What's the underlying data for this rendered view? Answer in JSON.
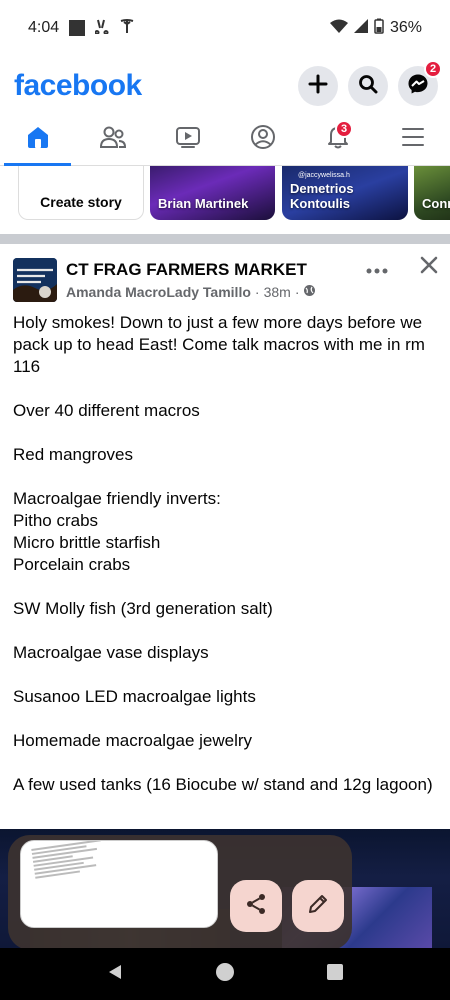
{
  "status_bar": {
    "time": "4:04",
    "battery": "36%",
    "icons": [
      "news-icon",
      "voicemail-icon",
      "tesla-icon",
      "wifi-icon",
      "signal-icon",
      "battery-icon"
    ]
  },
  "header": {
    "logo": "facebook",
    "actions": [
      {
        "name": "create-icon"
      },
      {
        "name": "search-icon"
      },
      {
        "name": "messenger-icon",
        "badge": "2"
      }
    ],
    "brand_color": "#1877f2"
  },
  "tabs": [
    {
      "name": "home",
      "icon": "home-icon",
      "active": true
    },
    {
      "name": "friends",
      "icon": "friends-icon"
    },
    {
      "name": "video",
      "icon": "video-icon"
    },
    {
      "name": "profile",
      "icon": "profile-icon"
    },
    {
      "name": "notifications",
      "icon": "bell-icon",
      "badge": "3"
    },
    {
      "name": "menu",
      "icon": "menu-icon"
    }
  ],
  "stories": {
    "create_label": "Create story",
    "items": [
      {
        "label": "Brian Martinek"
      },
      {
        "label": "Demetrios Kontoulis",
        "tag": "@jaccywelissa.h"
      },
      {
        "label": "Conr"
      }
    ]
  },
  "post": {
    "group_name": "CT FRAG FARMERS MARKET",
    "author": "Amanda MacroLady Tamillo",
    "time": "38m",
    "separator": "·",
    "body": "Holy smokes!  Down to just a few more days before we pack up to head East!  Come talk macros with me in rm 116\n\nOver 40 different macros\n\nRed mangroves\n\nMacroalgae friendly inverts:\nPitho crabs\nMicro brittle starfish\nPorcelain crabs\n\nSW Molly fish (3rd generation salt)\n\nMacroalgae vase displays\n\nSusanoo LED macroalgae lights\n\nHomemade macroalgae jewelry\n\nA few used tanks (16 Biocube w/ stand and 12g lagoon)"
  },
  "screenshot_preview": {
    "actions": [
      "share-icon",
      "edit-icon"
    ],
    "accent": "#f5d5cf"
  },
  "nav_bar": {
    "buttons": [
      "back-icon",
      "home-circle-icon",
      "recents-icon"
    ]
  }
}
